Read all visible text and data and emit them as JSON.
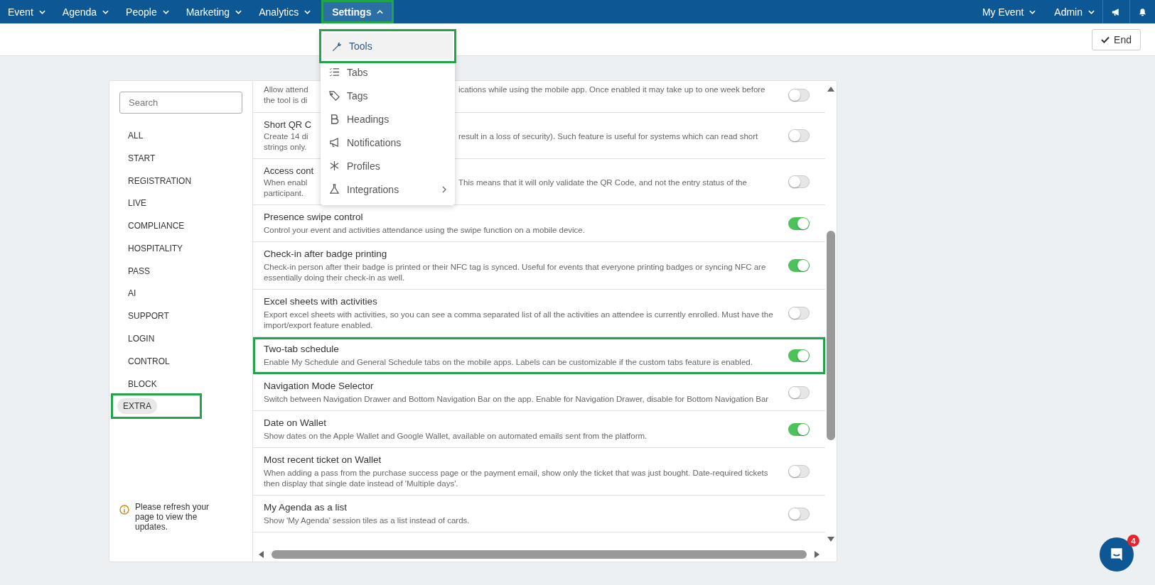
{
  "nav": {
    "left": [
      {
        "label": "Event",
        "open": false,
        "highlighted": false
      },
      {
        "label": "Agenda",
        "open": false,
        "highlighted": false
      },
      {
        "label": "People",
        "open": false,
        "highlighted": false
      },
      {
        "label": "Marketing",
        "open": false,
        "highlighted": false
      },
      {
        "label": "Analytics",
        "open": false,
        "highlighted": false
      },
      {
        "label": "Settings",
        "open": true,
        "highlighted": true
      }
    ],
    "right": [
      {
        "label": "My Event",
        "open": false
      },
      {
        "label": "Admin",
        "open": false
      }
    ]
  },
  "settings_menu": [
    {
      "label": "Tools",
      "selected": true,
      "highlighted": true,
      "submenu": false
    },
    {
      "label": "Tabs",
      "selected": false,
      "highlighted": false,
      "submenu": false
    },
    {
      "label": "Tags",
      "selected": false,
      "highlighted": false,
      "submenu": false
    },
    {
      "label": "Headings",
      "selected": false,
      "highlighted": false,
      "submenu": false
    },
    {
      "label": "Notifications",
      "selected": false,
      "highlighted": false,
      "submenu": false
    },
    {
      "label": "Profiles",
      "selected": false,
      "highlighted": false,
      "submenu": false
    },
    {
      "label": "Integrations",
      "selected": false,
      "highlighted": false,
      "submenu": true
    }
  ],
  "end_button": "End",
  "sidebar": {
    "search": {
      "placeholder": "Search"
    },
    "items": [
      {
        "label": "ALL",
        "selected": false,
        "highlighted": false
      },
      {
        "label": "START",
        "selected": false,
        "highlighted": false
      },
      {
        "label": "REGISTRATION",
        "selected": false,
        "highlighted": false
      },
      {
        "label": "LIVE",
        "selected": false,
        "highlighted": false
      },
      {
        "label": "COMPLIANCE",
        "selected": false,
        "highlighted": false
      },
      {
        "label": "HOSPITALITY",
        "selected": false,
        "highlighted": false
      },
      {
        "label": "PASS",
        "selected": false,
        "highlighted": false
      },
      {
        "label": "AI",
        "selected": false,
        "highlighted": false
      },
      {
        "label": "SUPPORT",
        "selected": false,
        "highlighted": false
      },
      {
        "label": "LOGIN",
        "selected": false,
        "highlighted": false
      },
      {
        "label": "CONTROL",
        "selected": false,
        "highlighted": false
      },
      {
        "label": "BLOCK",
        "selected": false,
        "highlighted": false
      },
      {
        "label": "EXTRA",
        "selected": true,
        "highlighted": true
      }
    ],
    "notice": "Please refresh your page to view the updates."
  },
  "tools": [
    {
      "kind": "covered",
      "left_lines": [
        "Allow attend",
        "the tool is di"
      ],
      "right_lines": [
        "ications while using the mobile app. Once enabled it may take up to one week before"
      ],
      "on": false,
      "highlighted": false
    },
    {
      "kind": "covered",
      "title_left": "Short QR C",
      "left_lines": [
        "Create 14 di",
        "strings only."
      ],
      "right_lines": [
        "result in a loss of security). Such feature is useful for systems which can read short"
      ],
      "on": false,
      "highlighted": false
    },
    {
      "kind": "covered",
      "title_left": "Access cont",
      "left_lines": [
        "When enabl",
        "participant."
      ],
      "right_lines": [
        "This means that it will only validate the QR Code, and not the entry status of the"
      ],
      "on": false,
      "highlighted": false
    },
    {
      "kind": "full",
      "title": "Presence swipe control",
      "description": "Control your event and activities attendance using the swipe function on a mobile device.",
      "on": true,
      "highlighted": false
    },
    {
      "kind": "full",
      "title": "Check-in after badge printing",
      "description": "Check-in person after their badge is printed or their NFC tag is synced. Useful for events that everyone printing badges or syncing NFC are essentially doing their check-in as well.",
      "on": true,
      "highlighted": false
    },
    {
      "kind": "full",
      "title": "Excel sheets with activities",
      "description": "Export excel sheets with activities, so you can see a comma separated list of all the activities an attendee is currently enrolled. Must have the import/export feature enabled.",
      "on": false,
      "highlighted": false
    },
    {
      "kind": "full",
      "title": "Two-tab schedule",
      "description": "Enable My Schedule and General Schedule tabs on the mobile apps. Labels can be customizable if the custom tabs feature is enabled.",
      "on": true,
      "highlighted": true
    },
    {
      "kind": "full",
      "title": "Navigation Mode Selector",
      "description": "Switch between Navigation Drawer and Bottom Navigation Bar on the app. Enable for Navigation Drawer, disable for Bottom Navigation Bar",
      "on": false,
      "highlighted": false
    },
    {
      "kind": "full",
      "title": "Date on Wallet",
      "description": "Show dates on the Apple Wallet and Google Wallet, available on automated emails sent from the platform.",
      "on": true,
      "highlighted": false
    },
    {
      "kind": "full",
      "title": "Most recent ticket on Wallet",
      "description": "When adding a pass from the purchase success page or the payment email, show only the ticket that was just bought. Date-required tickets then display that single date instead of 'Multiple days'.",
      "on": false,
      "highlighted": false
    },
    {
      "kind": "full",
      "title": "My Agenda as a list",
      "description": "Show 'My Agenda' session tiles as a list instead of cards.",
      "on": false,
      "highlighted": false
    }
  ],
  "chat_badge": "4"
}
